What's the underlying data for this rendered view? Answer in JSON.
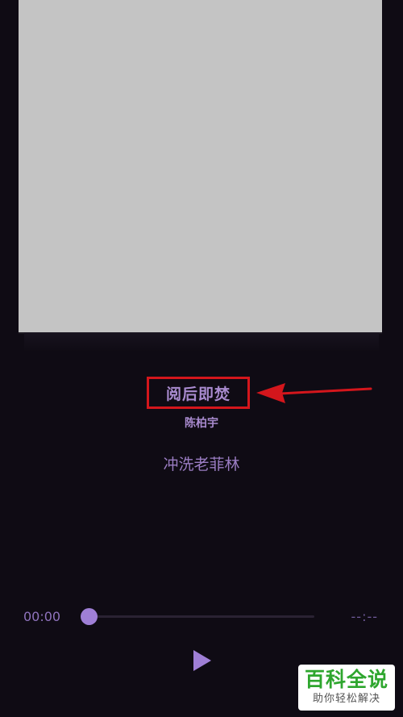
{
  "song": {
    "title": "阅后即焚",
    "artist": "陈柏宇",
    "lyric": "冲洗老菲林"
  },
  "player": {
    "current_time": "00:00",
    "total_time": "--:--",
    "progress": 0
  },
  "annotation": {
    "box_color": "#d4161c",
    "arrow_color": "#d4161c"
  },
  "watermark": {
    "main": "百科全说",
    "sub": "助你轻松解决"
  },
  "colors": {
    "background": "#0f0b14",
    "accent": "#9f7fd6",
    "text": "#a98bcf",
    "cover": "#c4c4c4"
  },
  "icons": {
    "play": "play-icon",
    "arrow": "red-arrow-icon"
  }
}
